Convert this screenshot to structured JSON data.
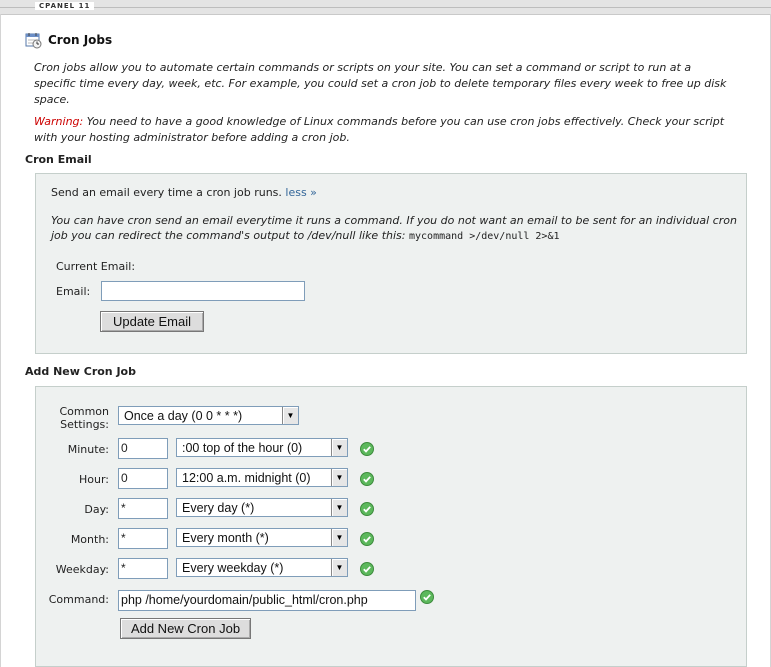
{
  "app": {
    "brand": "CPANEL 11"
  },
  "page": {
    "title": "Cron Jobs",
    "icon": "calendar-clock-icon",
    "intro": "Cron jobs allow you to automate certain commands or scripts on your site. You can set a command or script to run at a specific time every day, week, etc. For example, you could set a cron job to delete temporary files every week to free up disk space.",
    "warning_label": "Warning:",
    "warning_text": " You need to have a good knowledge of Linux commands before you can use cron jobs effectively. Check your script with your hosting administrator before adding a cron job."
  },
  "cron_email": {
    "section_title": "Cron Email",
    "send_text": "Send an email every time a cron job runs. ",
    "less_link": "less »",
    "description": "You can have cron send an email everytime it runs a command. If you do not want an email to be sent for an individual cron job you can redirect the command's output to /dev/null like this: ",
    "example_command": "mycommand >/dev/null 2>&1",
    "current_email_label": "Current Email:",
    "email_label": "Email:",
    "email_value": "",
    "update_button": "Update Email"
  },
  "add_cron": {
    "section_title": "Add New Cron Job",
    "common_settings_label_1": "Common",
    "common_settings_label_2": "Settings:",
    "common_settings_value": "Once a day (0 0 * * *)",
    "fields": [
      {
        "label": "Minute:",
        "value": "0",
        "select": ":00 top of the hour (0)"
      },
      {
        "label": "Hour:",
        "value": "0",
        "select": "12:00 a.m. midnight (0)"
      },
      {
        "label": "Day:",
        "value": "*",
        "select": "Every day (*)"
      },
      {
        "label": "Month:",
        "value": "*",
        "select": "Every month (*)"
      },
      {
        "label": "Weekday:",
        "value": "*",
        "select": "Every weekday (*)"
      }
    ],
    "command_label": "Command:",
    "command_value": "php /home/yourdomain/public_html/cron.php",
    "add_button": "Add New Cron Job"
  },
  "colors": {
    "warning": "#cc0000",
    "link": "#336699",
    "box_background": "#eef1f0",
    "valid_check": "#5cb85c"
  }
}
